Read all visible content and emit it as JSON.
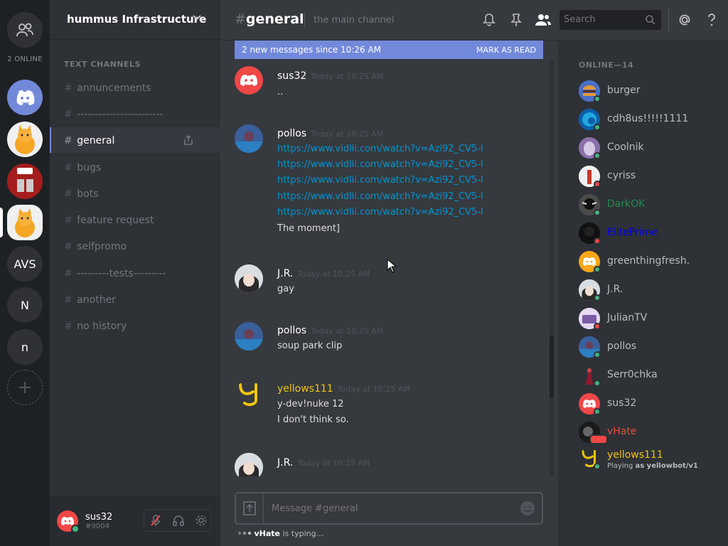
{
  "guilds": {
    "online_label": "2 ONLINE",
    "text_avs": "AVS",
    "text_n1": "N",
    "text_n2": "n"
  },
  "server": {
    "name": "hummus Infrastructure"
  },
  "channels": {
    "category": "TEXT CHANNELS",
    "items": [
      {
        "name": "annuncements"
      },
      {
        "name": "------------------------"
      },
      {
        "name": "general"
      },
      {
        "name": "bugs"
      },
      {
        "name": "bots"
      },
      {
        "name": "feature request"
      },
      {
        "name": "selfpromo"
      },
      {
        "name": "---------tests---------"
      },
      {
        "name": "another"
      },
      {
        "name": "no history"
      }
    ]
  },
  "user_panel": {
    "username": "sus32",
    "discriminator": "#9004"
  },
  "header": {
    "channel": "general",
    "hash": "#",
    "topic": "the main channel",
    "search_placeholder": "Search"
  },
  "new_messages": {
    "text": "2 new messages since 10:26 AM",
    "action": "MARK AS READ"
  },
  "messages": [
    {
      "author": "sus32",
      "ts": "Today at 10:25 AM",
      "lines": [
        ".."
      ]
    },
    {
      "author": "pollos",
      "ts": "Today at 10:25 AM",
      "links": [
        "https://www.vidlii.com/watch?v=Azi92_CV5-l",
        "https://www.vidlii.com/watch?v=Azi92_CV5-l",
        "https://www.vidlii.com/watch?v=Azi92_CV5-l",
        "https://www.vidlii.com/watch?v=Azi92_CV5-l",
        "https://www.vidlii.com/watch?v=Azi92_CV5-l"
      ],
      "lines": [
        "The moment]"
      ]
    },
    {
      "author": "J.R.",
      "ts": "Today at 10:25 AM",
      "lines": [
        "gay"
      ]
    },
    {
      "author": "pollos",
      "ts": "Today at 10:25 AM",
      "lines": [
        "soup park clip"
      ]
    },
    {
      "author": "yellows111",
      "ts": "Today at 10:25 AM",
      "lines": [
        "y-dev!nuke 12",
        "I don't think so."
      ]
    },
    {
      "author": "J.R.",
      "ts": "Today at 10:25 AM",
      "lines": []
    }
  ],
  "composer": {
    "placeholder": "Message #general"
  },
  "typing": {
    "user": "vHate",
    "text": " is typing..."
  },
  "members": {
    "header": "ONLINE—14",
    "list": [
      {
        "name": "burger",
        "color": "#b9bbbe",
        "status": "#43b581"
      },
      {
        "name": "cdh8us!!!!!1111",
        "color": "#b9bbbe",
        "status": "#43b581"
      },
      {
        "name": "Coolnik",
        "color": "#b9bbbe",
        "status": "#43b581"
      },
      {
        "name": "cyriss",
        "color": "#b9bbbe",
        "status": "#f04747"
      },
      {
        "name": "DarkOK",
        "color": "#1f8b4c",
        "status": "#43b581"
      },
      {
        "name": "ElitePrime",
        "color": "#0000e0",
        "status": "#f04747"
      },
      {
        "name": "greenthingfresh.",
        "color": "#b9bbbe",
        "status": "#43b581"
      },
      {
        "name": "J.R.",
        "color": "#b9bbbe",
        "status": "#43b581"
      },
      {
        "name": "JulianTV",
        "color": "#b9bbbe",
        "status": "#f04747"
      },
      {
        "name": "pollos",
        "color": "#b9bbbe",
        "status": "#43b581"
      },
      {
        "name": "Serr0chka",
        "color": "#b9bbbe",
        "status": "#43b581"
      },
      {
        "name": "sus32",
        "color": "#b9bbbe",
        "status": "#43b581"
      },
      {
        "name": "vHate",
        "color": "#e74c3c",
        "status": "#f04747"
      },
      {
        "name": "yellows111",
        "color": "#f1c40f",
        "status": "#43b581",
        "activity_prefix": "Playing ",
        "activity": "as yellowbot/v1"
      }
    ]
  },
  "colors": {
    "accent": "#7289da",
    "link": "#0096cf",
    "online": "#43b581",
    "dnd": "#f04747",
    "yellow": "#f1c40f"
  }
}
